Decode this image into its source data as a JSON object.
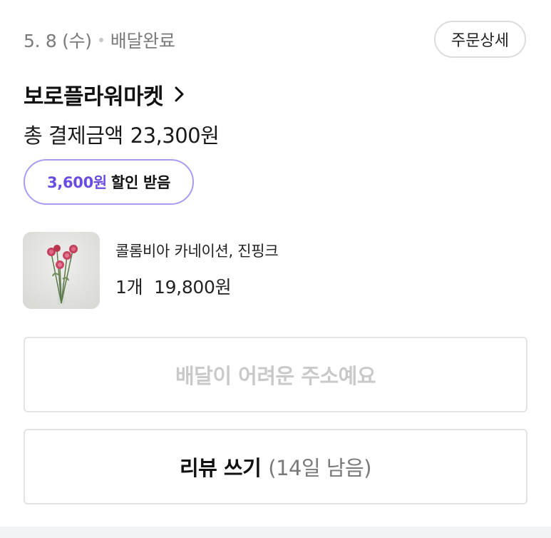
{
  "order": {
    "date": "5. 8 (수)",
    "status": "배달완료",
    "detail_button": "주문상세"
  },
  "store": {
    "name": "보로플라워마켓"
  },
  "payment": {
    "label": "총 결제금액",
    "amount": "23,300원"
  },
  "discount": {
    "amount": "3,600원",
    "label": "할인 받음"
  },
  "product": {
    "name": "콜롬비아 카네이션, 진핑크",
    "quantity": "1개",
    "price": "19,800원",
    "thumbnail_icon": "carnation-flower-image"
  },
  "actions": {
    "delivery_issue": "배달이 어려운 주소예요",
    "review_label": "리뷰 쓰기",
    "review_remaining": "(14일 남음)"
  },
  "colors": {
    "accent": "#6a4de0",
    "accent_border": "#a89cf0",
    "muted_text": "#7b7b7b",
    "disabled_text": "#c9c9c9",
    "border": "#e3e3e3"
  }
}
